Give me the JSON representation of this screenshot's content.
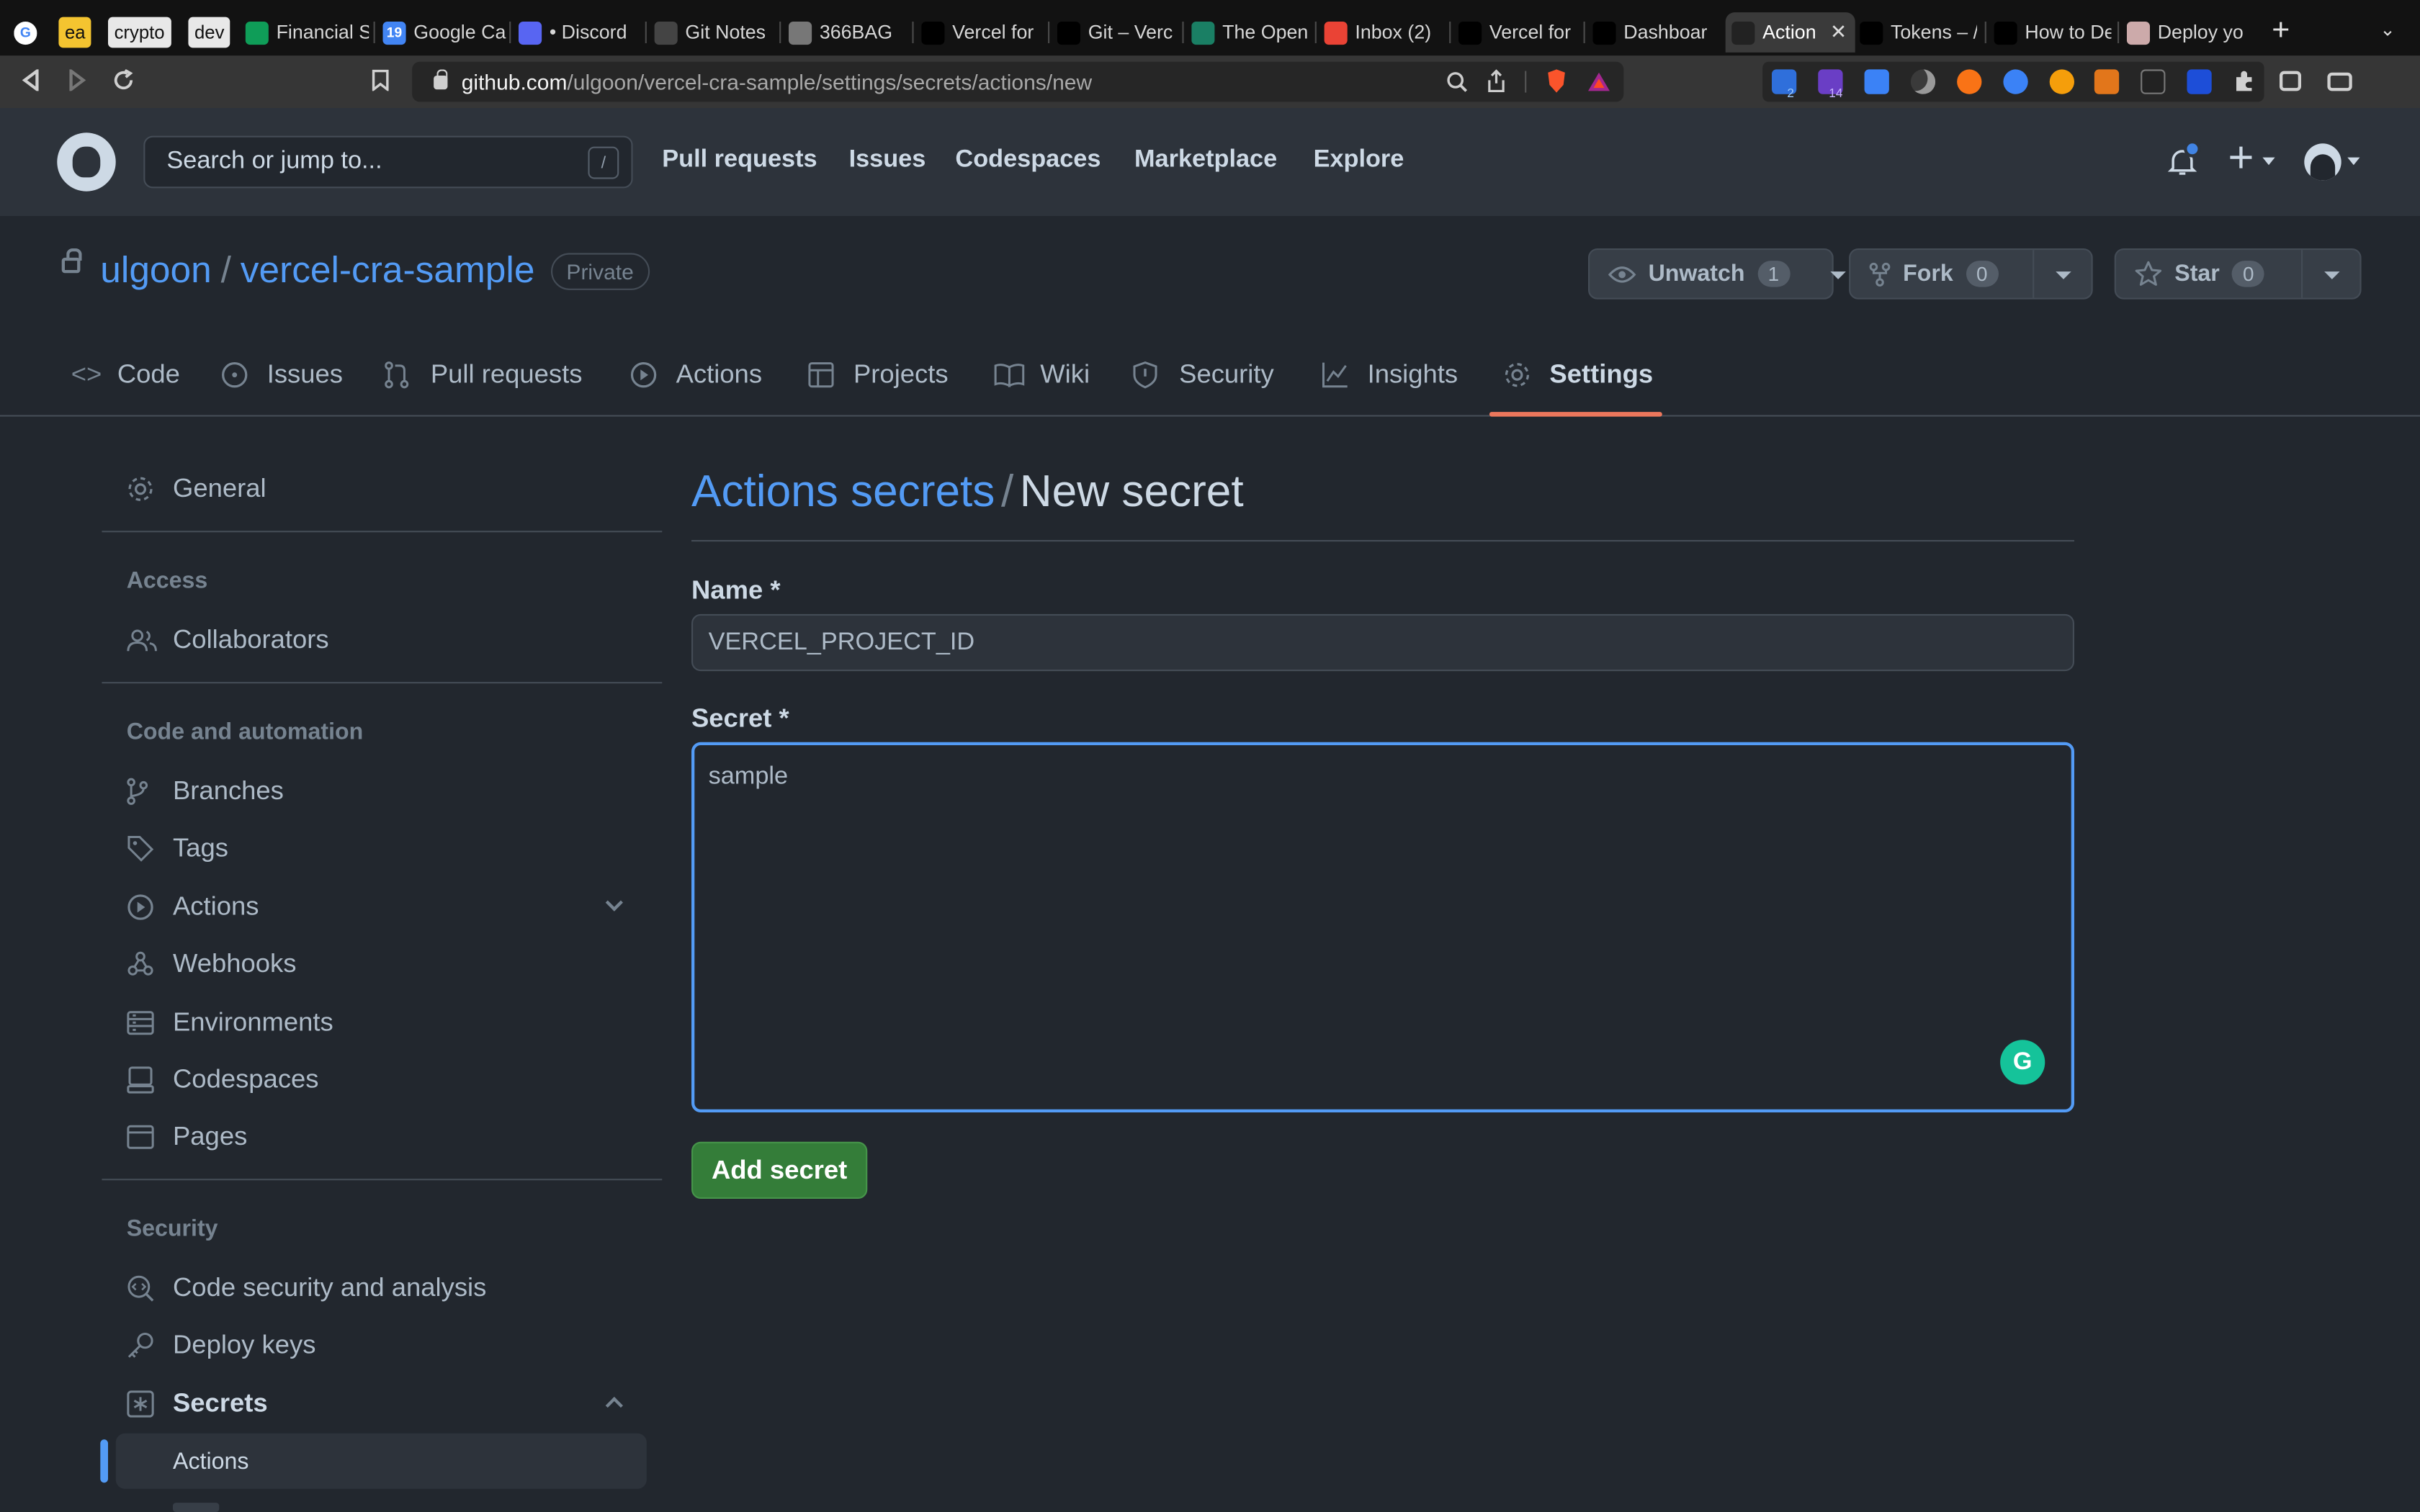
{
  "browser": {
    "pinned": [
      {
        "label": "ea",
        "bg": "#f4c430",
        "fg": "#111"
      },
      {
        "label": "crypto",
        "bg": "#e8e8e8",
        "fg": "#111"
      },
      {
        "label": "dev",
        "bg": "#e8e8e8",
        "fg": "#111"
      }
    ],
    "tabs": [
      {
        "title": "Financial S",
        "icon": "sheets-icon",
        "color": "#0f9d58"
      },
      {
        "title": "Google Ca",
        "icon": "calendar-icon",
        "color": "#4285f4",
        "glyph": "19"
      },
      {
        "title": "• Discord",
        "icon": "discord-icon",
        "color": "#5865f2"
      },
      {
        "title": "Git Notes",
        "icon": "notes-icon",
        "color": "#444"
      },
      {
        "title": "366BAG",
        "icon": "globe-icon",
        "color": "#777"
      },
      {
        "title": "Vercel for",
        "icon": "vercel-icon",
        "color": "#000"
      },
      {
        "title": "Git – Verc",
        "icon": "vercel-icon",
        "color": "#000"
      },
      {
        "title": "The Open",
        "icon": "openai-icon",
        "color": "#1a7f64"
      },
      {
        "title": "Inbox (2)",
        "icon": "gmail-icon",
        "color": "#ea4335"
      },
      {
        "title": "Vercel for",
        "icon": "vercel-icon",
        "color": "#000"
      },
      {
        "title": "Dashboar",
        "icon": "vercel-icon",
        "color": "#000"
      },
      {
        "title": "Action",
        "icon": "github-icon",
        "color": "#222",
        "active": true
      },
      {
        "title": "Tokens – /",
        "icon": "vercel-icon",
        "color": "#000"
      },
      {
        "title": "How to De",
        "icon": "vercel-icon",
        "color": "#000"
      },
      {
        "title": "Deploy yo",
        "icon": "avatar-icon",
        "color": "#caa"
      }
    ],
    "url_host": "github.com",
    "url_path": "/ulgoon/vercel-cra-sample/settings/secrets/actions/new",
    "ext_badges": [
      "2",
      "14"
    ]
  },
  "header": {
    "search_placeholder": "Search or jump to...",
    "search_shortcut": "/",
    "nav": [
      "Pull requests",
      "Issues",
      "Codespaces",
      "Marketplace",
      "Explore"
    ]
  },
  "repo": {
    "owner": "ulgoon",
    "name": "vercel-cra-sample",
    "visibility": "Private",
    "watch_label": "Unwatch",
    "watch_count": "1",
    "fork_label": "Fork",
    "fork_count": "0",
    "star_label": "Star",
    "star_count": "0"
  },
  "repo_tabs": [
    "Code",
    "Issues",
    "Pull requests",
    "Actions",
    "Projects",
    "Wiki",
    "Security",
    "Insights",
    "Settings"
  ],
  "sidebar": {
    "general": "General",
    "access_heading": "Access",
    "collaborators": "Collaborators",
    "code_heading": "Code and automation",
    "code_items": [
      "Branches",
      "Tags",
      "Actions",
      "Webhooks",
      "Environments",
      "Codespaces",
      "Pages"
    ],
    "security_heading": "Security",
    "security_items": [
      "Code security and analysis",
      "Deploy keys",
      "Secrets"
    ],
    "secrets_sub": [
      "Actions"
    ]
  },
  "main": {
    "title_link": "Actions secrets",
    "title_sep": "/",
    "title_rest": "New secret",
    "name_label": "Name *",
    "name_value": "VERCEL_PROJECT_ID",
    "secret_label": "Secret *",
    "secret_value": "sample",
    "submit_label": "Add secret"
  },
  "colors": {
    "accent": "#539bf5",
    "primary_button": "#347d39",
    "selected_tab_underline": "#ec775c"
  }
}
